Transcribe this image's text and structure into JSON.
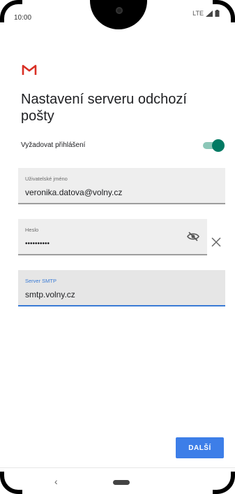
{
  "status_bar": {
    "time": "10:00",
    "network": "LTE"
  },
  "screen": {
    "title": "Nastavení serveru odchozí pošty",
    "require_login": {
      "label": "Vyžadovat přihlášení",
      "enabled": true
    }
  },
  "fields": {
    "username": {
      "label": "Uživatelské jméno",
      "value": "veronika.datova@volny.cz"
    },
    "password": {
      "label": "Heslo",
      "value": "••••••••••"
    },
    "smtp": {
      "label": "Server SMTP",
      "value": "smtp.volny.cz"
    }
  },
  "buttons": {
    "next": "DALŠÍ"
  },
  "nav": {
    "back": "‹"
  },
  "colors": {
    "accent": "#3d7ee8",
    "toggle_on": "#017a63",
    "gmail_red": "#d93025"
  }
}
